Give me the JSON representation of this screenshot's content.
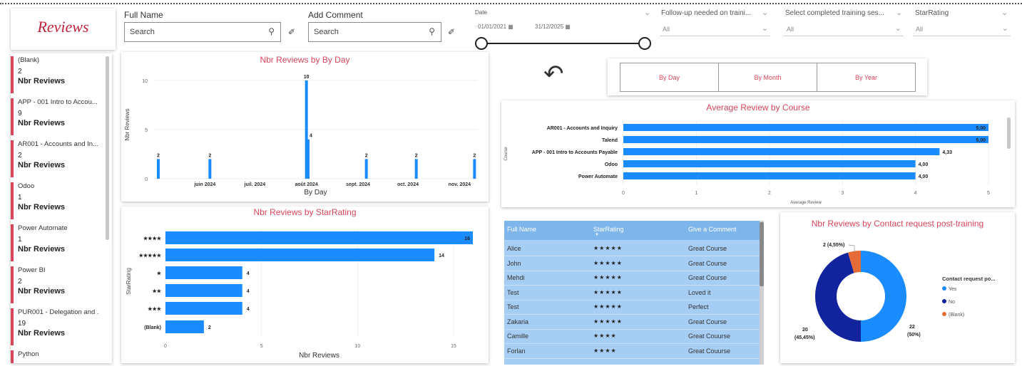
{
  "logo": {
    "text": "Reviews"
  },
  "filters": {
    "full_name": {
      "label": "Full Name",
      "placeholder": "Search"
    },
    "add_comment": {
      "label": "Add Comment",
      "placeholder": "Search"
    },
    "date": {
      "label": "Date",
      "start": "01/01/2021",
      "end": "31/12/2025"
    },
    "followup": {
      "label": "Follow-up needed on traini...",
      "value": "All"
    },
    "session": {
      "label": "Select completed training ses...",
      "value": "All"
    },
    "starrating": {
      "label": "StarRating",
      "value": "All"
    }
  },
  "left_list": {
    "measure_label": "Nbr Reviews",
    "items": [
      {
        "name": "(Blank)",
        "count": "2"
      },
      {
        "name": "APP - 001 Intro to Accou...",
        "count": "9"
      },
      {
        "name": "AR001 - Accounts and In...",
        "count": "2"
      },
      {
        "name": "Odoo",
        "count": "1"
      },
      {
        "name": "Power Automate",
        "count": "1"
      },
      {
        "name": "Power BI",
        "count": "2"
      },
      {
        "name": "PUR001 - Delegation and ...",
        "count": "19"
      },
      {
        "name": "Python",
        "count": ""
      }
    ]
  },
  "buttons": {
    "day": "By Day",
    "month": "By Month",
    "year": "By Year"
  },
  "colors": {
    "accent": "#d6455a",
    "bar": "#1a8cff",
    "navy": "#12239e",
    "orange": "#e66c37"
  },
  "table": {
    "headers": [
      "Full Name",
      "StarRating",
      "Give a Comment"
    ],
    "rows": [
      [
        "Alice",
        "★★★★★",
        "Great Course"
      ],
      [
        "John",
        "★★★★★",
        "Great Course"
      ],
      [
        "Mehdi",
        "★★★★★",
        "Great Course"
      ],
      [
        "Test",
        "★★★★★",
        "Loved it"
      ],
      [
        "Test",
        "★★★★★",
        "Perfect"
      ],
      [
        "Zakaria",
        "★★★★★",
        "Great Course"
      ],
      [
        "Camille",
        "★★★★",
        "Great Couurse"
      ],
      [
        "Forlan",
        "★★★★",
        "Great Couurse"
      ]
    ]
  },
  "chart_data": [
    {
      "type": "bar",
      "title": "Nbr Reviews by By Day",
      "xlabel": "By Day",
      "ylabel": "Nbr Reviews",
      "ylim": [
        0,
        11
      ],
      "yticks": [
        0,
        5,
        10
      ],
      "xtick_labels": [
        "juin 2024",
        "juil. 2024",
        "août 2024",
        "sept. 2024",
        "oct. 2024",
        "nov. 2024"
      ],
      "x": [
        "2024-05-04",
        "2024-06-04",
        "2024-08-01",
        "2024-08-02",
        "2024-09-06",
        "2024-10-06",
        "2024-11-10"
      ],
      "values": [
        2,
        2,
        10,
        4,
        2,
        2,
        2
      ]
    },
    {
      "type": "bar",
      "orientation": "horizontal",
      "title": "Average Review by Course",
      "xlabel": "Average Review",
      "ylabel": "Course",
      "xlim": [
        0,
        5
      ],
      "xticks": [
        0,
        1,
        2,
        3,
        4,
        5
      ],
      "categories": [
        "AR001 - Accounts and Inquiry",
        "Talend",
        "APP - 001 Intro to Accounts Payable",
        "Odoo",
        "Power Automate"
      ],
      "values": [
        5.0,
        5.0,
        4.33,
        4.0,
        4.0
      ],
      "labels": [
        "5,00",
        "5,00",
        "4,33",
        "4,00",
        "4,00"
      ]
    },
    {
      "type": "bar",
      "orientation": "horizontal",
      "title": "Nbr Reviews by StarRating",
      "xlabel": "Nbr Reviews",
      "ylabel": "StarRating",
      "xlim": [
        0,
        16
      ],
      "xticks": [
        0,
        5,
        10,
        15
      ],
      "categories": [
        "★★★★",
        "★★★★★",
        "★",
        "★★",
        "★★★",
        "(Blank)"
      ],
      "values": [
        16,
        14,
        4,
        4,
        4,
        2
      ]
    },
    {
      "type": "pie",
      "donut": true,
      "title": "Nbr Reviews by Contact request post-training",
      "legend_title": "Contact request po...",
      "legend_position": "right",
      "series": [
        {
          "name": "Yes",
          "value": 22,
          "label": "22\n(50%)"
        },
        {
          "name": "No",
          "value": 20,
          "label": "20\n(45,45%)"
        },
        {
          "name": "(Blank)",
          "value": 2,
          "label": "2 (4,55%)"
        }
      ]
    }
  ]
}
